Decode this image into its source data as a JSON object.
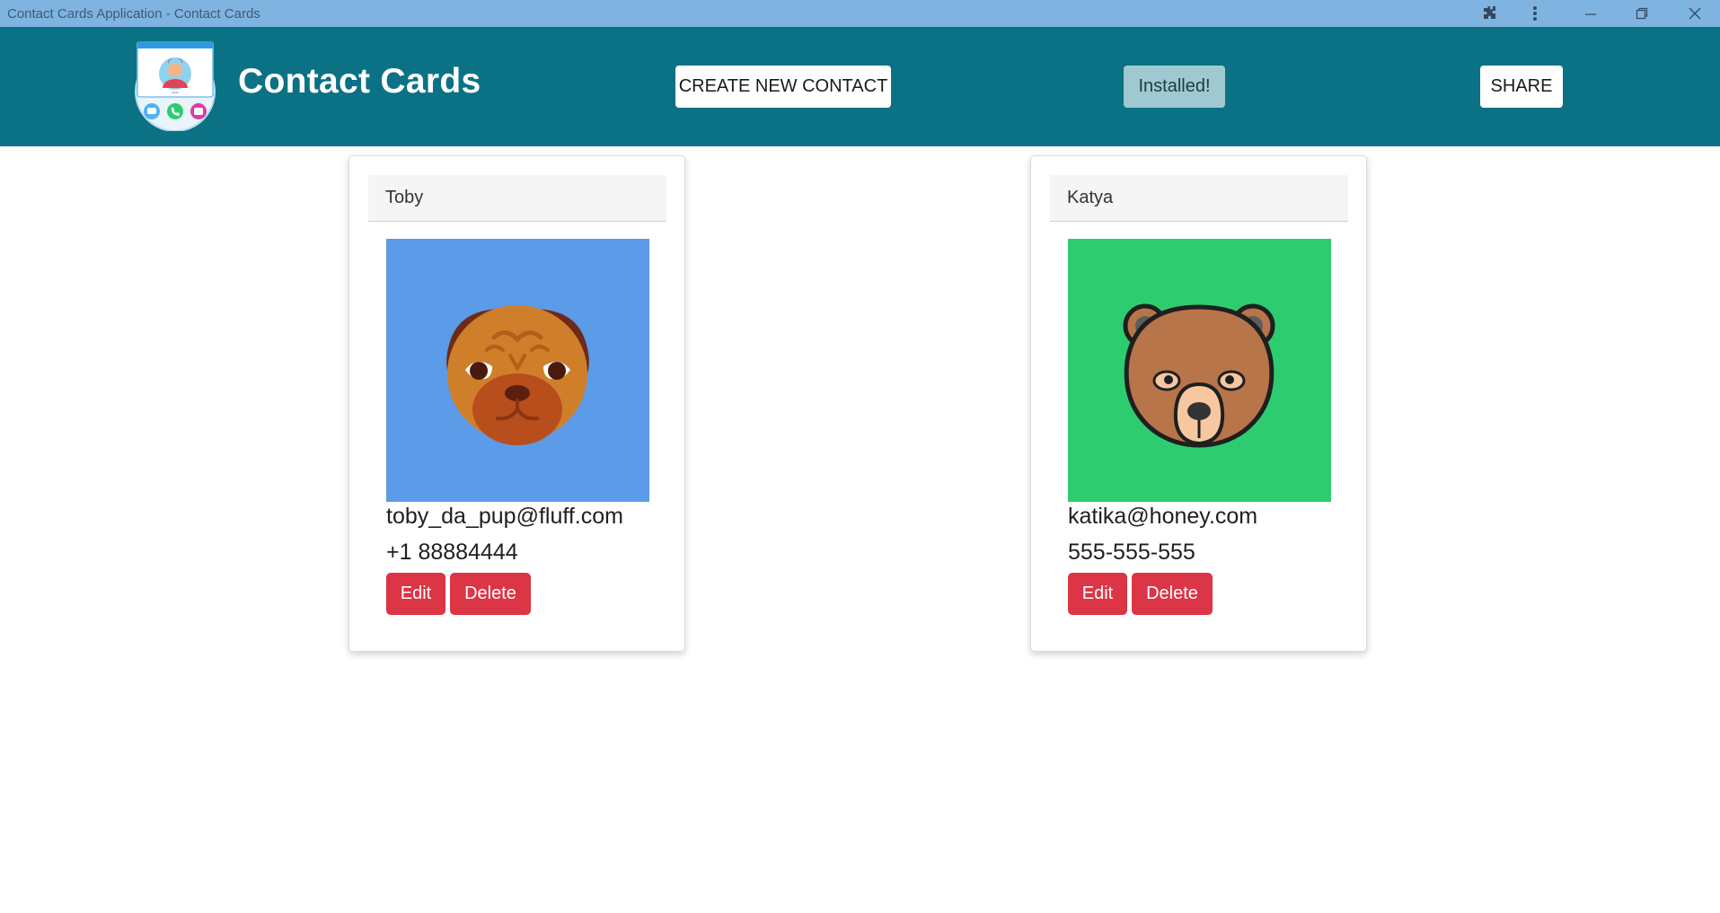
{
  "window": {
    "title": "Contact Cards Application - Contact Cards",
    "icons": [
      "puzzle-icon",
      "more-vertical-icon",
      "minimize-icon",
      "restore-icon",
      "close-icon"
    ]
  },
  "header": {
    "app_title": "Contact Cards",
    "create_label": "CREATE NEW CONTACT",
    "installed_label": "Installed!",
    "share_label": "SHARE",
    "background": "#0b7285"
  },
  "contacts": [
    {
      "name": "Toby",
      "email": "toby_da_pup@fluff.com",
      "phone": "+1 88884444",
      "avatar": "pug-icon",
      "avatar_bg": "#5b9be8",
      "edit_label": "Edit",
      "delete_label": "Delete"
    },
    {
      "name": "Katya",
      "email": "katika@honey.com",
      "phone": "555-555-555",
      "avatar": "bear-icon",
      "avatar_bg": "#2ecc71",
      "edit_label": "Edit",
      "delete_label": "Delete"
    }
  ],
  "colors": {
    "danger": "#dc3545",
    "titlebar": "#7fb3e0"
  }
}
